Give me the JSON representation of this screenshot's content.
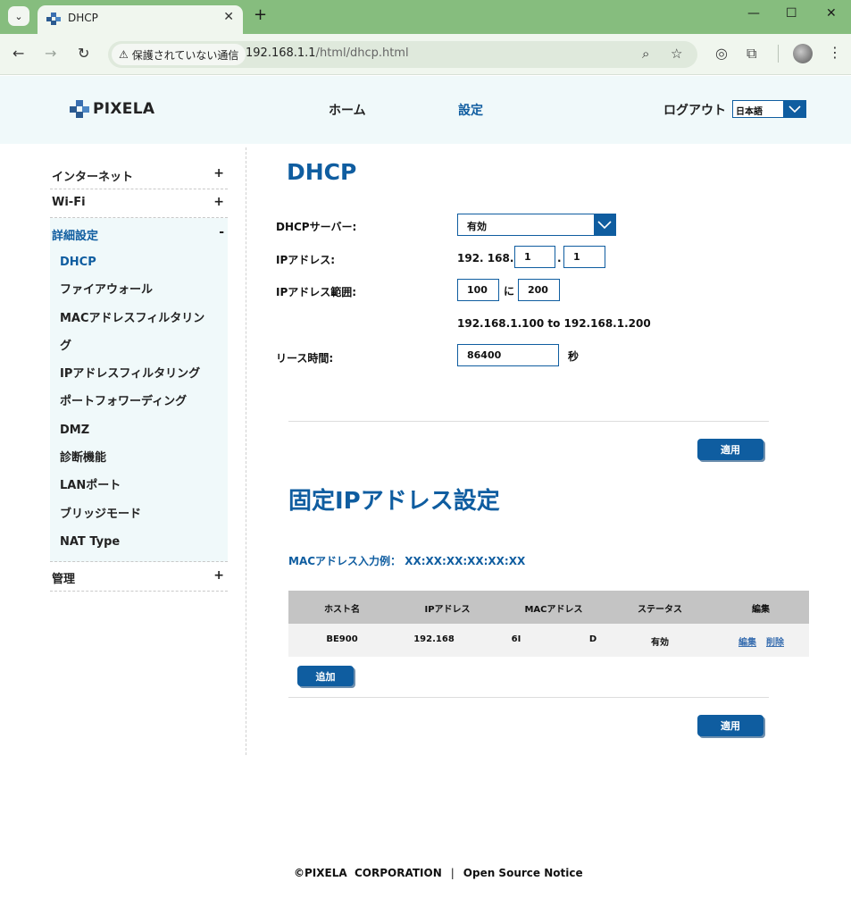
{
  "browser": {
    "tab_title": "DHCP",
    "security_label": "保護されていない通信",
    "url_host": "192.168.1.1",
    "url_path": "/html/dhcp.html"
  },
  "header": {
    "logo_text": "PIXELA",
    "nav": {
      "home": "ホーム",
      "settings": "設定",
      "logout": "ログアウト"
    },
    "language": "日本語"
  },
  "sidebar": {
    "internet": {
      "label": "インターネット",
      "toggle": "+"
    },
    "wifi": {
      "label": "Wi-Fi",
      "toggle": "+"
    },
    "advanced": {
      "label": "詳細設定",
      "toggle": "-",
      "items": [
        "DHCP",
        "ファイアウォール",
        "MACアドレスフィルタリン",
        "グ",
        "IPアドレスフィルタリング",
        "ポートフォワーディング",
        "DMZ",
        "診断機能",
        "LANポート",
        "ブリッジモード",
        "NAT Type"
      ]
    },
    "management": {
      "label": "管理",
      "toggle": "+"
    }
  },
  "dhcp": {
    "title": "DHCP",
    "server_label": "DHCPサーバー:",
    "server_value": "有効",
    "ip_label": "IPアドレス:",
    "ip_prefix": "192. 168.",
    "ip_octet3": "1",
    "ip_dot": ".",
    "ip_octet4": "1",
    "range_label": "IPアドレス範囲:",
    "range_start": "100",
    "range_joiner": "に",
    "range_end": "200",
    "range_summary": "192.168.1.100 to 192.168.1.200",
    "lease_label": "リース時間:",
    "lease_value": "86400",
    "lease_unit": "秒",
    "apply_label": "適用"
  },
  "static_ip": {
    "title": "固定IPアドレス設定",
    "mac_hint": "MACアドレス入力例： XX:XX:XX:XX:XX:XX",
    "columns": [
      "ホスト名",
      "IPアドレス",
      "MACアドレス",
      "ステータス",
      "編集"
    ],
    "row": {
      "host": "BE900",
      "ip": "192.168",
      "mac_a": "6I",
      "mac_b": "D",
      "status": "有効",
      "edit": "編集",
      "delete": "削除"
    },
    "add_label": "追加",
    "apply_label": "適用"
  },
  "footer": {
    "copyright": "©PIXELA  CORPORATION",
    "separator": "|",
    "oss_link": "Open Source Notice"
  }
}
